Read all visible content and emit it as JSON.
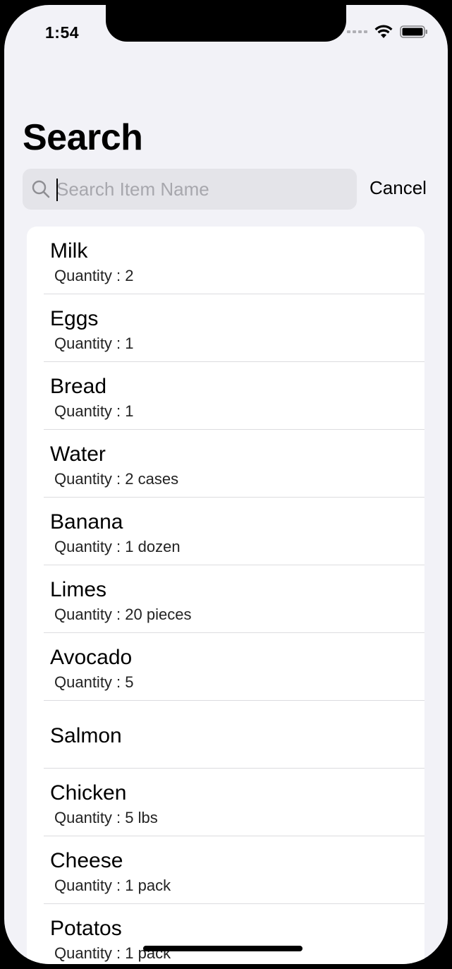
{
  "status_bar": {
    "time": "1:54"
  },
  "page": {
    "title": "Search"
  },
  "search": {
    "placeholder": "Search Item Name",
    "value": "",
    "cancel_label": "Cancel"
  },
  "items": [
    {
      "name": "Milk",
      "quantity": "Quantity : 2"
    },
    {
      "name": "Eggs",
      "quantity": "Quantity : 1"
    },
    {
      "name": "Bread",
      "quantity": "Quantity : 1"
    },
    {
      "name": "Water",
      "quantity": "Quantity : 2 cases"
    },
    {
      "name": "Banana",
      "quantity": "Quantity : 1 dozen"
    },
    {
      "name": "Limes",
      "quantity": "Quantity : 20 pieces"
    },
    {
      "name": "Avocado",
      "quantity": "Quantity : 5"
    },
    {
      "name": "Salmon",
      "quantity": ""
    },
    {
      "name": "Chicken",
      "quantity": "Quantity : 5 lbs"
    },
    {
      "name": "Cheese",
      "quantity": "Quantity : 1 pack"
    },
    {
      "name": "Potatos",
      "quantity": "Quantity : 1 pack"
    }
  ]
}
